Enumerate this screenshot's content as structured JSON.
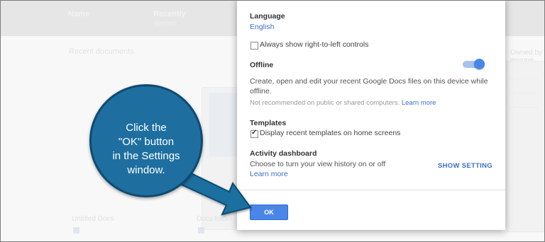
{
  "background_app": {
    "tabs": [
      "Name",
      "Recently",
      ""
    ],
    "tab_sub": "opened",
    "heading": "Recent documents",
    "right_label": "Owned by anyone",
    "card_titles": [
      "Untitled Docs",
      "Docs folder",
      ""
    ]
  },
  "settings": {
    "language": {
      "title": "Language",
      "value": "English"
    },
    "rtl_controls": {
      "label": "Always show right-to-left controls",
      "checked": false
    },
    "offline": {
      "title": "Offline",
      "enabled": true,
      "description": "Create, open and edit your recent Google Docs files on this device while offline.",
      "note": "Not recommended on public or shared computers.",
      "learn_more": "Learn more"
    },
    "templates": {
      "title": "Templates",
      "label": "Display recent templates on home screens",
      "checked": true
    },
    "activity_dashboard": {
      "title": "Activity dashboard",
      "description": "Choose to turn your view history on or off",
      "learn_more": "Learn more",
      "show_setting": "SHOW SETTING"
    },
    "ok_label": "OK"
  },
  "callout": {
    "text": "Click the \"OK\" button in the Settings window.",
    "line1": "Click the",
    "line2": "\"OK\" button",
    "line3": "in the Settings",
    "line4": "window.",
    "color": "#1e6fa0"
  },
  "colors": {
    "accent": "#4a86e8",
    "link": "#3b6ec6"
  }
}
